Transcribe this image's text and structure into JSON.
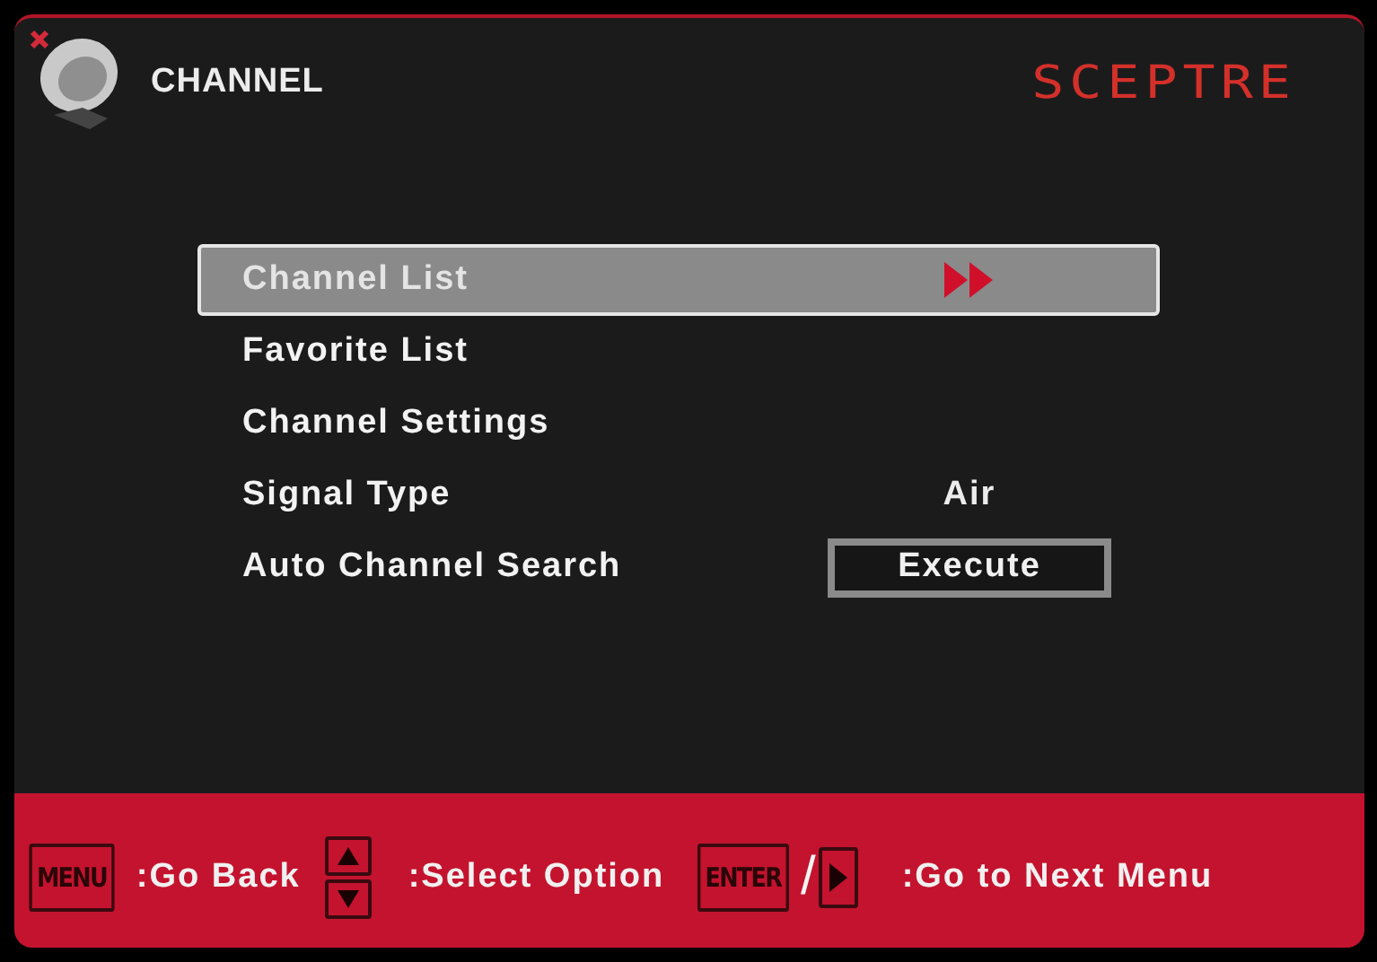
{
  "header": {
    "title": "CHANNEL",
    "brand": "SCEPTRE"
  },
  "menu": [
    {
      "label": "Channel List",
      "selected": true,
      "kind": "submenu"
    },
    {
      "label": "Favorite List",
      "selected": false,
      "kind": "plain"
    },
    {
      "label": "Channel Settings",
      "selected": false,
      "kind": "plain"
    },
    {
      "label": "Signal Type",
      "selected": false,
      "kind": "value",
      "value": "Air"
    },
    {
      "label": "Auto Channel Search",
      "selected": false,
      "kind": "button",
      "button": "Execute"
    }
  ],
  "footer": [
    {
      "kind": "key",
      "key": "MENU",
      "text": ":Go Back"
    },
    {
      "kind": "updown",
      "text": ":Select Option"
    },
    {
      "kind": "enter",
      "key": "ENTER",
      "separator": "/",
      "text": ":Go to Next Menu"
    }
  ]
}
